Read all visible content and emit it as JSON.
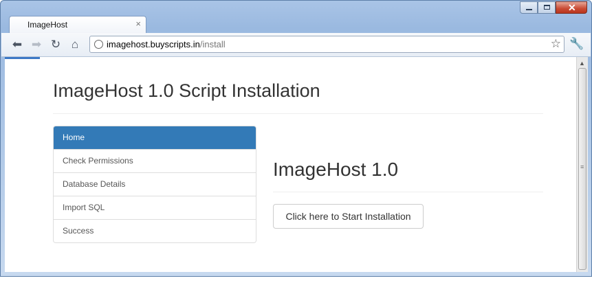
{
  "browser": {
    "tab_title": "ImageHost",
    "tab_close_icon": "×",
    "address": {
      "host": "imagehost.buyscripts.in",
      "path": "/install"
    }
  },
  "page": {
    "title": "ImageHost 1.0 Script Installation",
    "menu": [
      {
        "label": "Home",
        "active": true
      },
      {
        "label": "Check Permissions",
        "active": false
      },
      {
        "label": "Database Details",
        "active": false
      },
      {
        "label": "Import SQL",
        "active": false
      },
      {
        "label": "Success",
        "active": false
      }
    ],
    "content_title": "ImageHost 1.0",
    "start_button": "Click here to Start Installation"
  },
  "colors": {
    "active_menu": "#337ab7",
    "close_button": "#c94a33"
  }
}
